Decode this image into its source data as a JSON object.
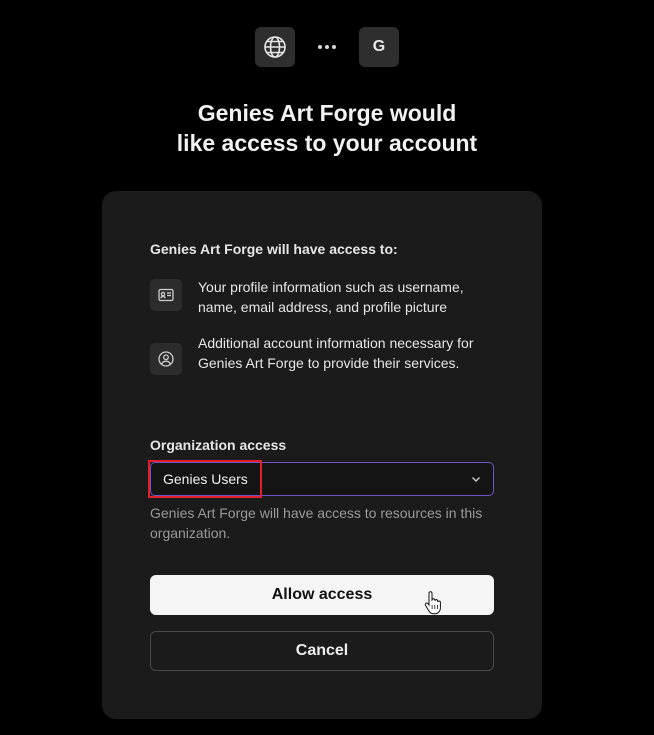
{
  "header": {
    "app_initial": "G",
    "icons": [
      "globe-icon",
      "more-dots-icon"
    ]
  },
  "title": {
    "line1": "Genies Art Forge would",
    "line2": "like access to your account"
  },
  "permissions": {
    "heading": "Genies Art Forge will have access to:",
    "items": [
      {
        "icon": "id-card-icon",
        "text": "Your profile information such as username, name, email address, and profile picture"
      },
      {
        "icon": "user-circle-icon",
        "text": "Additional account information necessary for Genies Art Forge to provide their services."
      }
    ]
  },
  "organization": {
    "label": "Organization access",
    "selected": "Genies Users",
    "help": "Genies Art Forge will have access to resources in this organization."
  },
  "buttons": {
    "allow": "Allow access",
    "cancel": "Cancel"
  },
  "colors": {
    "background": "#000000",
    "card": "#1b1b1b",
    "select_border": "#6f56c8",
    "highlight": "#e0202a",
    "allow_button": "#f5f5f5"
  }
}
